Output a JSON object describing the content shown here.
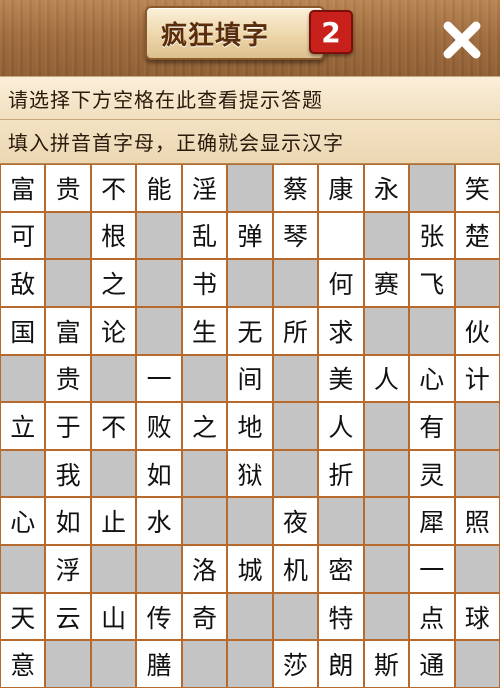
{
  "header": {
    "title": "疯狂填字",
    "badge": "2",
    "close_icon": "close-x-icon"
  },
  "hint_text": "请选择下方空格在此查看提示答题",
  "instruction_text": "填入拼音首字母，正确就会显示汉字",
  "colors": {
    "grid_line": "#b66a2e",
    "blocked_cell": "#c4c4c4",
    "open_cell": "#ffffff",
    "badge": "#c8201a"
  },
  "grid": [
    [
      "富",
      "贵",
      "不",
      "能",
      "淫",
      "#",
      "蔡",
      "康",
      "永",
      "#",
      "笑"
    ],
    [
      "可",
      "#",
      "根",
      "#",
      "乱",
      "弹",
      "琴",
      "",
      "#",
      "张",
      "楚"
    ],
    [
      "敌",
      "#",
      "之",
      "#",
      "书",
      "#",
      "#",
      "何",
      "赛",
      "飞",
      "#"
    ],
    [
      "国",
      "富",
      "论",
      "#",
      "生",
      "无",
      "所",
      "求",
      "#",
      "#",
      "伙"
    ],
    [
      "#",
      "贵",
      "#",
      "一",
      "#",
      "间",
      "#",
      "美",
      "人",
      "心",
      "计"
    ],
    [
      "立",
      "于",
      "不",
      "败",
      "之",
      "地",
      "#",
      "人",
      "#",
      "有",
      "#"
    ],
    [
      "#",
      "我",
      "#",
      "如",
      "#",
      "狱",
      "#",
      "折",
      "#",
      "灵",
      "#"
    ],
    [
      "心",
      "如",
      "止",
      "水",
      "#",
      "#",
      "夜",
      "#",
      "#",
      "犀",
      "照"
    ],
    [
      "#",
      "浮",
      "#",
      "#",
      "洛",
      "城",
      "机",
      "密",
      "#",
      "一",
      "#"
    ],
    [
      "天",
      "云",
      "山",
      "传",
      "奇",
      "#",
      "#",
      "特",
      "#",
      "点",
      "球"
    ],
    [
      "意",
      "#",
      "#",
      "膳",
      "#",
      "#",
      "莎",
      "朗",
      "斯",
      "通",
      "#"
    ]
  ]
}
